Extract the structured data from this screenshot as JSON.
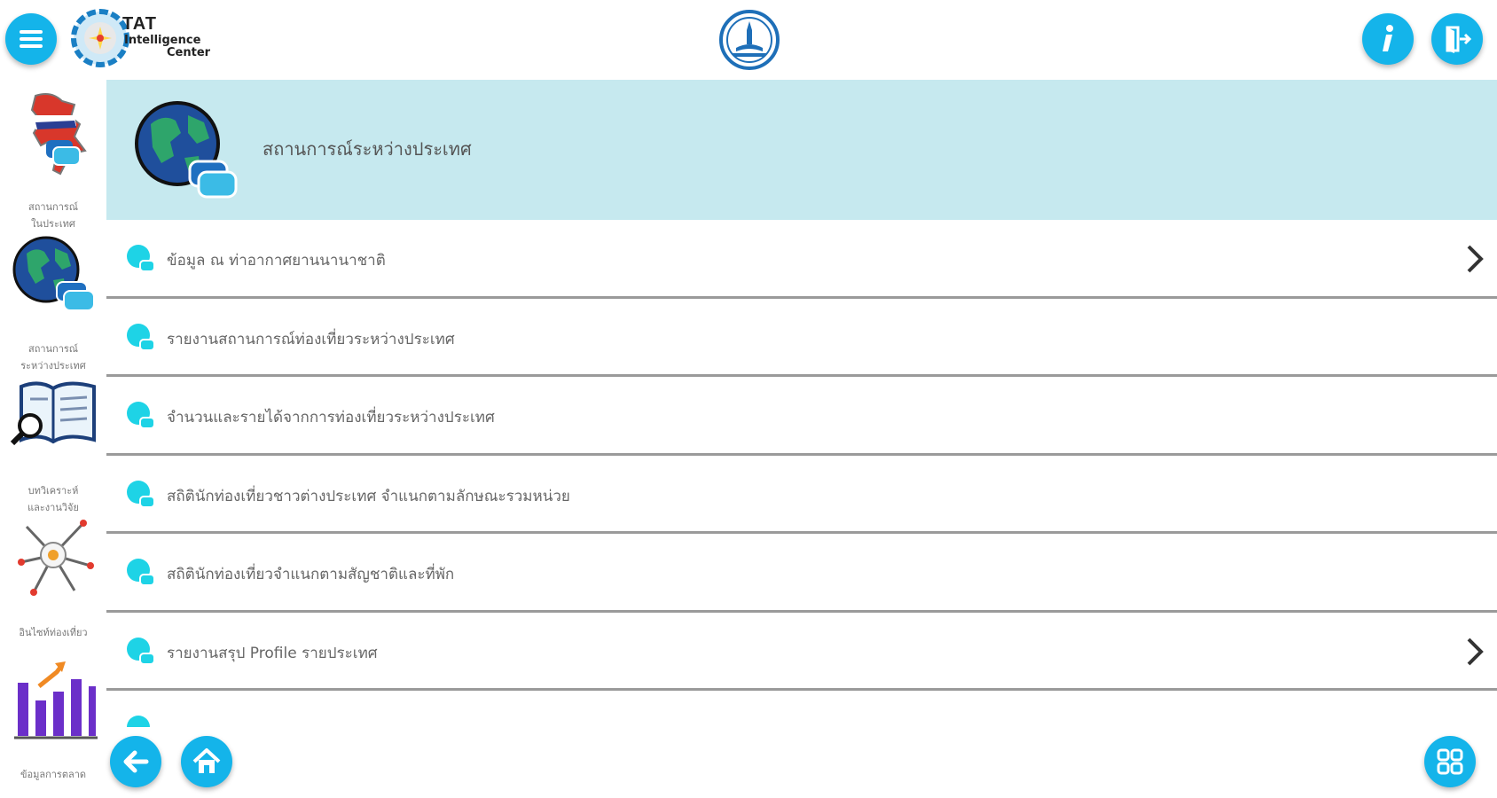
{
  "header": {
    "logo_title": "TAT",
    "logo_subtitle_1": "Intelligence",
    "logo_subtitle_2": "Center",
    "menu_icon": "hamburger-menu-icon",
    "info_icon": "info-icon",
    "logout_icon": "logout-icon",
    "emblem_icon": "tat-emblem-icon"
  },
  "sidebar": {
    "items": [
      {
        "label_line1": "สถานการณ์",
        "label_line2": "ในประเทศ",
        "icon": "thailand-map-chat-icon"
      },
      {
        "label_line1": "สถานการณ์",
        "label_line2": "ระหว่างประเทศ",
        "icon": "globe-chat-icon"
      },
      {
        "label_line1": "บทวิเคราะห์",
        "label_line2": "และงานวิจัย",
        "icon": "book-magnifier-icon"
      },
      {
        "label_line1": "อินไซท์ท่องเที่ยว",
        "label_line2": "",
        "icon": "tourism-insight-icon"
      },
      {
        "label_line1": "ข้อมูลการตลาด",
        "label_line2": "",
        "icon": "bar-chart-icon"
      }
    ]
  },
  "banner": {
    "title": "สถานการณ์ระหว่างประเทศ",
    "icon": "globe-chat-icon"
  },
  "list": {
    "rows": [
      {
        "label": "ข้อมูล ณ ท่าอากาศยานนานาชาติ",
        "has_chevron": true
      },
      {
        "label": "รายงานสถานการณ์ท่องเที่ยวระหว่างประเทศ",
        "has_chevron": false
      },
      {
        "label": "จำนวนและรายได้จากการท่องเที่ยวระหว่างประเทศ",
        "has_chevron": false
      },
      {
        "label": "สถิตินักท่องเที่ยวชาวต่างประเทศ จำแนกตามลักษณะรวมหน่วย",
        "has_chevron": false
      },
      {
        "label": "สถิตินักท่องเที่ยวจำแนกตามสัญชาติและที่พัก",
        "has_chevron": false
      },
      {
        "label": "รายงานสรุป Profile รายประเทศ",
        "has_chevron": true
      },
      {
        "label": "",
        "has_chevron": false
      }
    ]
  },
  "footer": {
    "back_icon": "arrow-left-icon",
    "home_icon": "home-icon",
    "grid_icon": "grid-apps-icon"
  },
  "colors": {
    "accent": "#14b4ea",
    "banner_bg": "#c6e9ef",
    "divider": "#9a9a9a",
    "row_icon": "#1ed3e6"
  }
}
